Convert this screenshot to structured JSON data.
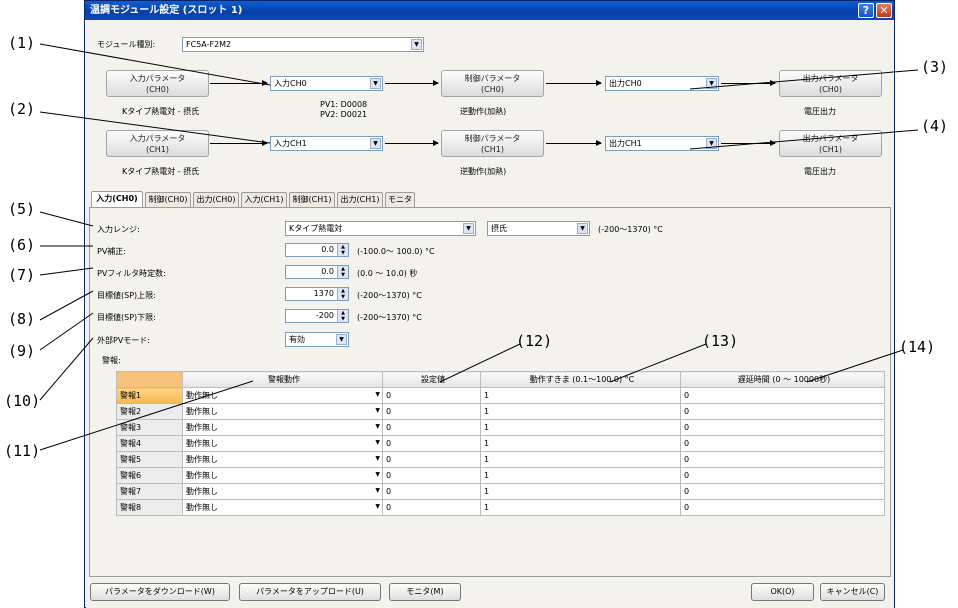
{
  "window": {
    "title": "温調モジュール設定 (スロット 1)",
    "help": "?",
    "close": "✕"
  },
  "module_type": {
    "label": "モジュール種別:",
    "value": "FC5A-F2M2"
  },
  "rows": [
    {
      "in_param": "入力パラメータ\n(CH0)",
      "sensor": "Kタイプ熱電対 - 摂氏",
      "input_sel": "入力CH0",
      "pv": "PV1: D0008\nPV2: D0021",
      "ctrl": "制御パラメータ\n(CH0)",
      "action": "逆動作(加熱)",
      "output_sel": "出力CH0",
      "out_param": "出力パラメータ\n(CH0)",
      "out_type": "電圧出力"
    },
    {
      "in_param": "入力パラメータ\n(CH1)",
      "sensor": "Kタイプ熱電対 - 摂氏",
      "input_sel": "入力CH1",
      "pv": "",
      "ctrl": "制御パラメータ\n(CH1)",
      "action": "逆動作(加熱)",
      "output_sel": "出力CH1",
      "out_param": "出力パラメータ\n(CH1)",
      "out_type": "電圧出力"
    }
  ],
  "tabs": [
    "入力(CH0)",
    "制御(CH0)",
    "出力(CH0)",
    "入力(CH1)",
    "制御(CH1)",
    "出力(CH1)",
    "モニタ"
  ],
  "form": {
    "input_range": {
      "label": "入力レンジ:",
      "value": "Kタイプ熱電対",
      "unit_value": "摂氏",
      "range": "(-200〜1370) °C"
    },
    "pv_offset": {
      "label": "PV補正:",
      "value": "0.0",
      "range": "(-100.0〜 100.0) °C"
    },
    "pv_filter": {
      "label": "PVフィルタ時定数:",
      "value": "0.0",
      "range": "(0.0 〜 10.0) 秒"
    },
    "sp_high": {
      "label": "目標値(SP)上限:",
      "value": "1370",
      "range": "(-200〜1370) °C"
    },
    "sp_low": {
      "label": "目標値(SP)下限:",
      "value": "-200",
      "range": "(-200〜1370) °C"
    },
    "ext_pv": {
      "label": "外部PVモード:",
      "value": "有効"
    },
    "alarm_label": "警報:"
  },
  "alarm_table": {
    "headers": [
      "警報動作",
      "設定値",
      "動作すきま (0.1〜100.0) °C",
      "遅延時間 (0 〜 10000秒)"
    ],
    "rows": [
      {
        "name": "警報1",
        "action": "動作無し",
        "set": "0",
        "hyst": "1",
        "delay": "0"
      },
      {
        "name": "警報2",
        "action": "動作無し",
        "set": "0",
        "hyst": "1",
        "delay": "0"
      },
      {
        "name": "警報3",
        "action": "動作無し",
        "set": "0",
        "hyst": "1",
        "delay": "0"
      },
      {
        "name": "警報4",
        "action": "動作無し",
        "set": "0",
        "hyst": "1",
        "delay": "0"
      },
      {
        "name": "警報5",
        "action": "動作無し",
        "set": "0",
        "hyst": "1",
        "delay": "0"
      },
      {
        "name": "警報6",
        "action": "動作無し",
        "set": "0",
        "hyst": "1",
        "delay": "0"
      },
      {
        "name": "警報7",
        "action": "動作無し",
        "set": "0",
        "hyst": "1",
        "delay": "0"
      },
      {
        "name": "警報8",
        "action": "動作無し",
        "set": "0",
        "hyst": "1",
        "delay": "0"
      }
    ]
  },
  "buttons": {
    "download": "パラメータをダウンロード(W)",
    "upload": "パラメータをアップロード(U)",
    "monitor": "モニタ(M)",
    "ok": "OK(O)",
    "cancel": "キャンセル(C)"
  },
  "callouts": [
    "(1)",
    "(2)",
    "(3)",
    "(4)",
    "(5)",
    "(6)",
    "(7)",
    "(8)",
    "(9)",
    "(10)",
    "(11)",
    "(12)",
    "(13)",
    "(14)"
  ]
}
